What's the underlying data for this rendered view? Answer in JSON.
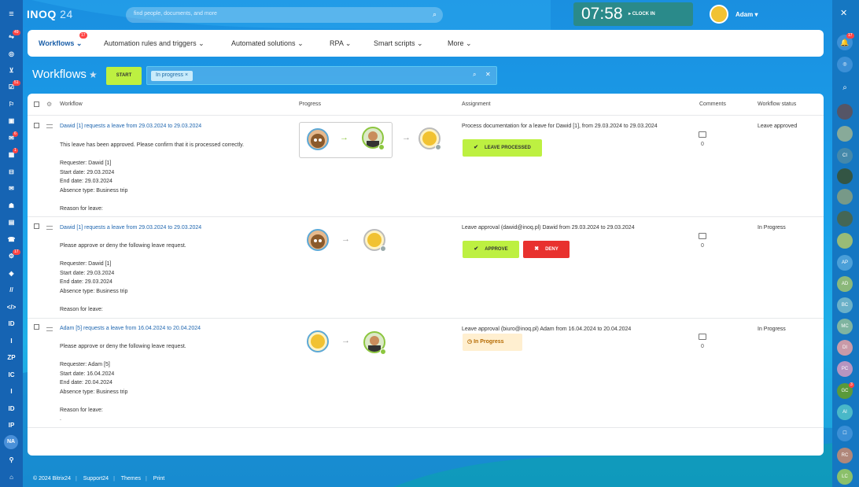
{
  "header": {
    "logo": "INOQ",
    "logo_num": "24",
    "search_placeholder": "find people, documents, and more",
    "clock_time": "07:58",
    "clock_in": "CLOCK IN",
    "user_name": "Adam"
  },
  "tabs": [
    {
      "label": "Workflows",
      "badge": "17"
    },
    {
      "label": "Automation rules and triggers"
    },
    {
      "label": "Automated solutions"
    },
    {
      "label": "RPA"
    },
    {
      "label": "Smart scripts"
    },
    {
      "label": "More"
    }
  ],
  "page": {
    "title": "Workflows",
    "start_label": "START",
    "filter_chip": "In progress"
  },
  "columns": {
    "workflow": "Workflow",
    "progress": "Progress",
    "assignment": "Assignment",
    "comments": "Comments",
    "status": "Workflow status"
  },
  "rows": [
    {
      "title": "Dawid [1] requests a leave from 29.03.2024 to 29.03.2024",
      "text": "This leave has been approved. Please confirm that it is processed correctly.\n\nRequester: Dawid [1]\nStart date: 29.03.2024\nEnd date: 29.03.2024\nAbsence type: Business trip\n\nReason for leave:",
      "assignment": "Process documentation for a leave for Dawid [1], from 29.03.2024 to 29.03.2024",
      "button": "LEAVE PROCESSED",
      "comments": "0",
      "status": "Leave approved"
    },
    {
      "title": "Dawid [1] requests a leave from 29.03.2024 to 29.03.2024",
      "text": "Please approve or deny the following leave request.\n\nRequester: Dawid [1]\nStart date: 29.03.2024\nEnd date: 29.03.2024\nAbsence type: Business trip\n\nReason for leave:",
      "assignment": "Leave approval (dawid@inoq.pl) Dawid from 29.03.2024 to 29.03.2024",
      "approve": "APPROVE",
      "deny": "DENY",
      "comments": "0",
      "status": "In Progress"
    },
    {
      "title": "Adam [5] requests a leave from 16.04.2024 to 20.04.2024",
      "text": "Please approve or deny the following leave request.\n\nRequester: Adam [5]\nStart date: 16.04.2024\nEnd date: 20.04.2024\nAbsence type: Business trip\n\nReason for leave:\n.",
      "assignment": "Leave approval (biuro@inoq.pl) Adam from 16.04.2024 to 20.04.2024",
      "badge": "In Progress",
      "comments": "0",
      "status": "In Progress"
    }
  ],
  "left_nav": {
    "badges": [
      "49",
      "51",
      "6",
      "1",
      "17"
    ],
    "labels": [
      "ID",
      "I",
      "ZP",
      "IC",
      "I",
      "ID",
      "IP",
      "NA"
    ]
  },
  "right_nav": {
    "badge": "17",
    "avatars": [
      "CI",
      "AP",
      "AD",
      "BC",
      "MC",
      "DI",
      "PC",
      "GC",
      "AI",
      "RC",
      "LC"
    ],
    "gc_badge": "3"
  },
  "footer": {
    "copyright": "© 2024 Bitrix24",
    "support": "Support24",
    "themes": "Themes",
    "print": "Print"
  }
}
